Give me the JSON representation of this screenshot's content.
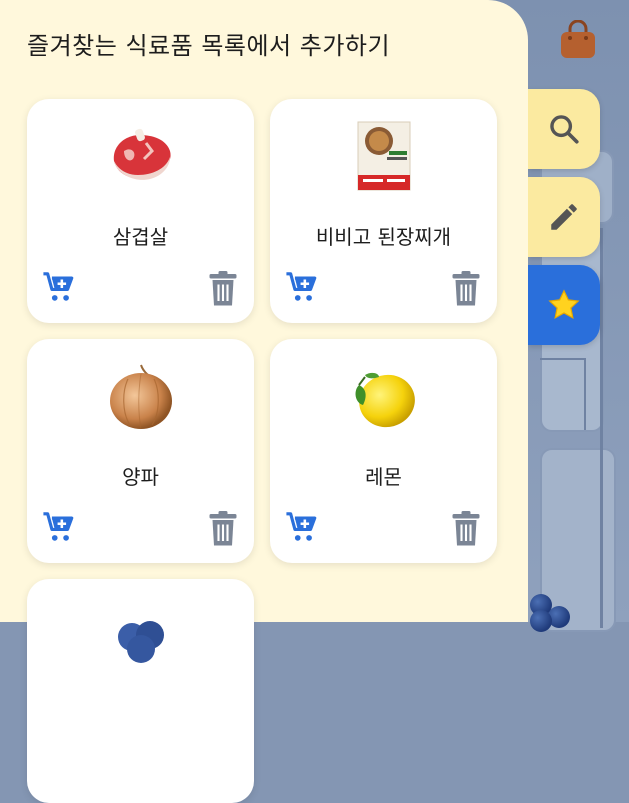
{
  "sheet": {
    "title": "즐겨찾는 식료품 목록에서 추가하기"
  },
  "side_buttons": [
    {
      "icon": "search-icon",
      "active": false
    },
    {
      "icon": "pencil-icon",
      "active": false
    },
    {
      "icon": "star-icon",
      "active": true
    }
  ],
  "top_right_icon": "shopping-bag-icon",
  "items": [
    {
      "name": "삼겹살",
      "image": "meat-steak-icon"
    },
    {
      "name": "비비고 된장찌개",
      "image": "doenjang-package-icon"
    },
    {
      "name": "양파",
      "image": "onion-icon"
    },
    {
      "name": "레몬",
      "image": "lemon-icon"
    },
    {
      "name": "",
      "image": "blueberry-icon"
    }
  ],
  "colors": {
    "sheet_bg": "#fff8dc",
    "accent_blue": "#2a6fdb",
    "button_yellow": "#fbeaa0",
    "trash_gray": "#7b8595",
    "bag_brown": "#b5602f"
  }
}
